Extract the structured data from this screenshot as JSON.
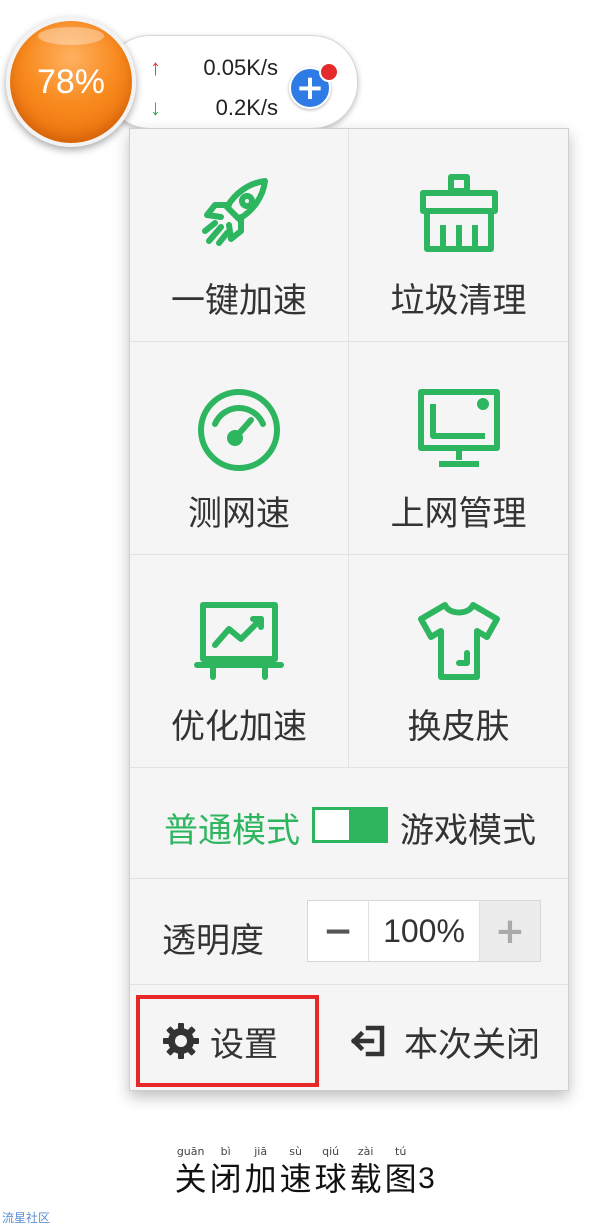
{
  "ball": {
    "percent": "78%",
    "upload_speed": "0.05K/s",
    "download_speed": "0.2K/s",
    "up_arrow": "↑",
    "down_arrow": "↓",
    "plus_symbol": "+"
  },
  "menu": {
    "tiles": [
      {
        "label": "一键加速",
        "icon": "rocket-icon"
      },
      {
        "label": "垃圾清理",
        "icon": "broom-icon"
      },
      {
        "label": "测网速",
        "icon": "speedometer-icon"
      },
      {
        "label": "上网管理",
        "icon": "monitor-icon"
      },
      {
        "label": "优化加速",
        "icon": "chart-board-icon"
      },
      {
        "label": "换皮肤",
        "icon": "tshirt-icon"
      }
    ],
    "mode": {
      "normal": "普通模式",
      "game": "游戏模式"
    },
    "opacity": {
      "label": "透明度",
      "value": "100%",
      "minus": "−",
      "plus": "+"
    },
    "settings_label": "设置",
    "close_label": "本次关闭"
  },
  "caption": {
    "chars": [
      {
        "hz": "关",
        "py": "guān"
      },
      {
        "hz": "闭",
        "py": "bì"
      },
      {
        "hz": "加",
        "py": "jiā"
      },
      {
        "hz": "速",
        "py": "sù"
      },
      {
        "hz": "球",
        "py": "qiú"
      },
      {
        "hz": "载",
        "py": "zài"
      },
      {
        "hz": "图",
        "py": "tú"
      }
    ],
    "number": "3"
  },
  "watermark": "流星社区",
  "colors": {
    "accent_green": "#2eb560",
    "ball_orange": "#f88a1e",
    "highlight_red": "#e62828",
    "plus_blue": "#2f7be6"
  }
}
